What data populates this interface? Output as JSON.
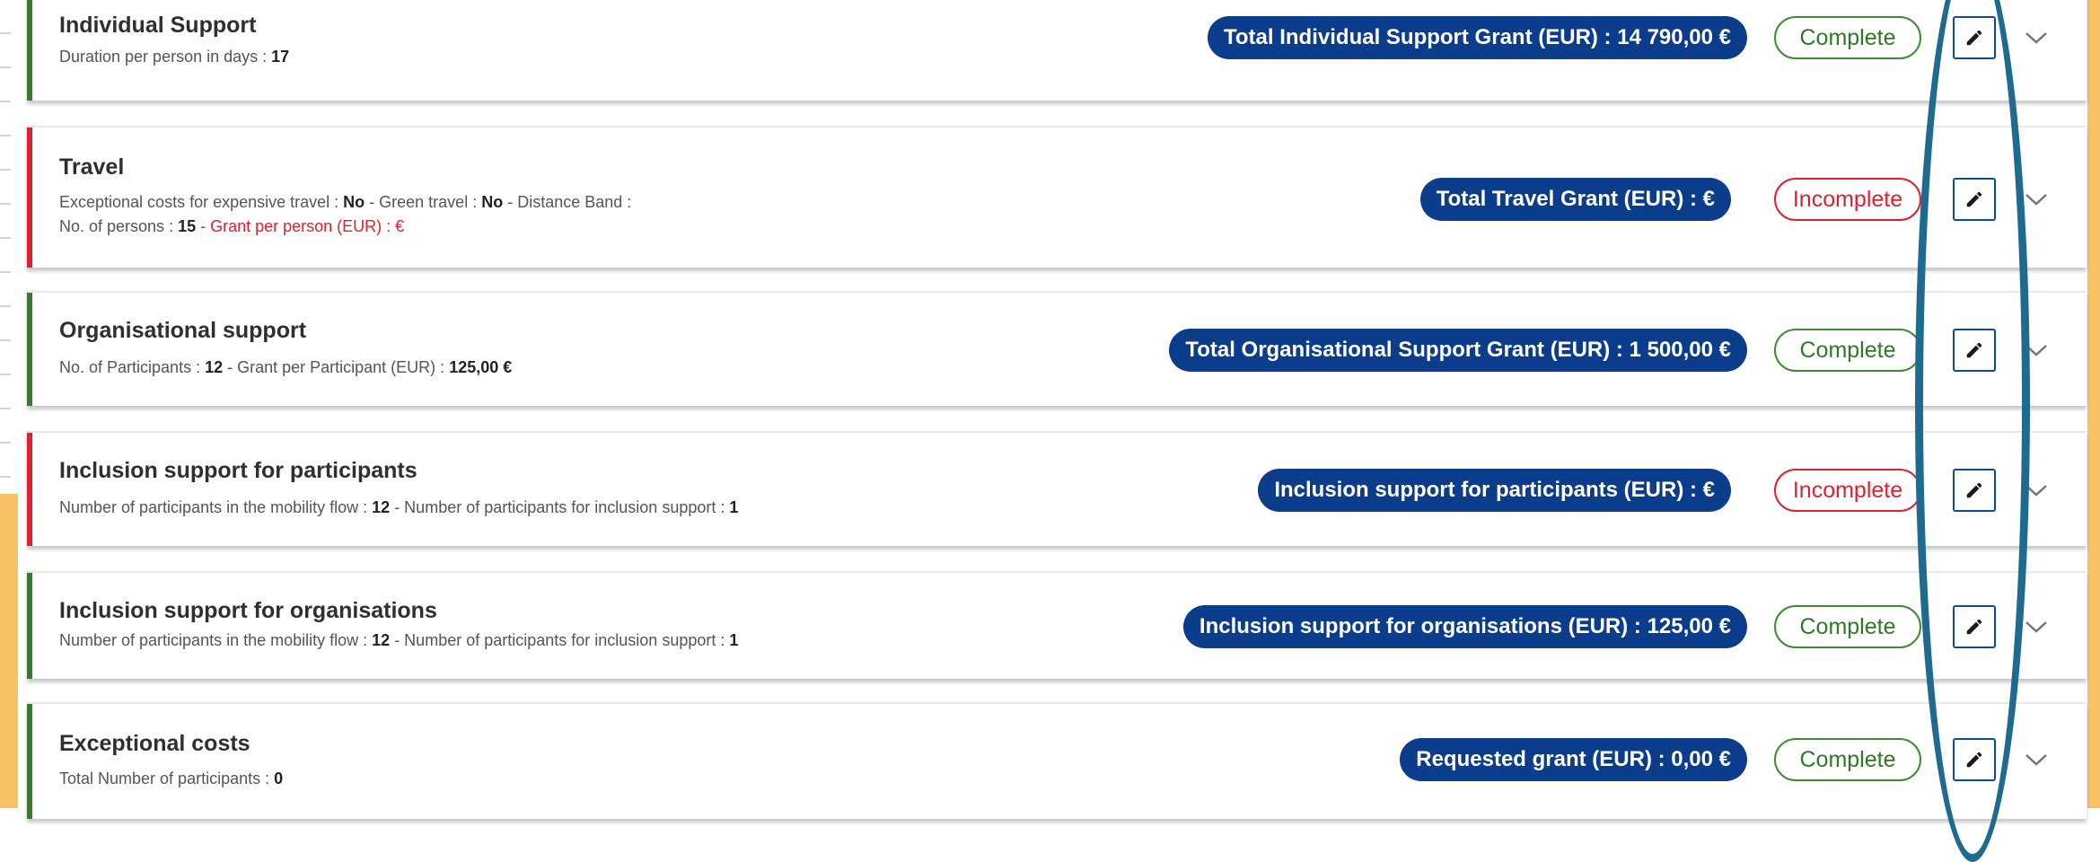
{
  "cards": [
    {
      "id": "individual",
      "title": "Individual Support",
      "detail_line1": [
        {
          "t": "Duration per person in days : "
        },
        {
          "t": "17",
          "b": true
        }
      ],
      "total_label": "Total Individual Support Grant (EUR) : 14 790,00 €",
      "status": "Complete",
      "state": "complete"
    },
    {
      "id": "travel",
      "title": "Travel",
      "detail_line1": [
        {
          "t": "Exceptional costs for expensive travel : "
        },
        {
          "t": "No",
          "b": true
        },
        {
          "t": " - Green travel : "
        },
        {
          "t": "No",
          "b": true
        },
        {
          "t": " - Distance Band :"
        }
      ],
      "detail_line2": [
        {
          "t": "No. of persons : "
        },
        {
          "t": "15",
          "b": true
        },
        {
          "t": " - "
        },
        {
          "t": "Grant per person (EUR) : €",
          "r": true
        }
      ],
      "total_label": "Total Travel Grant (EUR) :  €",
      "status": "Incomplete",
      "state": "incomplete"
    },
    {
      "id": "organisational",
      "title": "Organisational support",
      "detail_line1": [
        {
          "t": "No. of Participants : "
        },
        {
          "t": "12",
          "b": true
        },
        {
          "t": " - Grant per Participant (EUR) : "
        },
        {
          "t": "125,00 €",
          "b": true
        }
      ],
      "total_label": "Total Organisational Support Grant (EUR) : 1 500,00 €",
      "status": "Complete",
      "state": "complete"
    },
    {
      "id": "inclusion-participants",
      "title": "Inclusion support for participants",
      "detail_line1": [
        {
          "t": "Number of participants in the mobility flow : "
        },
        {
          "t": "12",
          "b": true
        },
        {
          "t": " - Number of participants for inclusion support : "
        },
        {
          "t": "1",
          "b": true
        }
      ],
      "total_label": "Inclusion support for participants (EUR) :  €",
      "status": "Incomplete",
      "state": "incomplete"
    },
    {
      "id": "inclusion-organisations",
      "title": "Inclusion support for organisations",
      "detail_line1": [
        {
          "t": "Number of participants in the mobility flow : "
        },
        {
          "t": "12",
          "b": true
        },
        {
          "t": " - Number of participants for inclusion support : "
        },
        {
          "t": "1",
          "b": true
        }
      ],
      "total_label": "Inclusion support for organisations (EUR) : 125,00 €",
      "status": "Complete",
      "state": "complete"
    },
    {
      "id": "exceptional",
      "title": "Exceptional costs",
      "detail_line1": [
        {
          "t": "Total Number of participants : "
        },
        {
          "t": "0",
          "b": true
        }
      ],
      "total_label": "Requested grant (EUR) : 0,00 €",
      "status": "Complete",
      "state": "complete"
    }
  ],
  "icons": {
    "edit": "pencil-icon",
    "expand": "chevron-down-icon"
  },
  "colors": {
    "complete": "#3e8a35",
    "incomplete": "#e0202f",
    "pill": "#0b3d8c",
    "annotation": "#1e6b8f"
  }
}
